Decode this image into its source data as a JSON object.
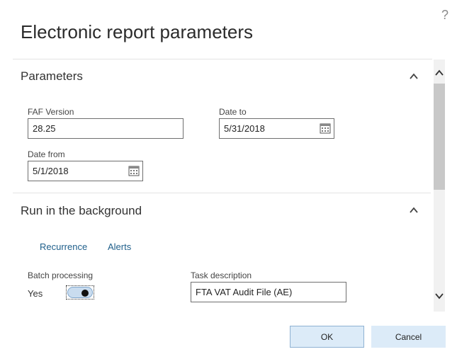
{
  "dialog": {
    "title": "Electronic report parameters",
    "help": "?"
  },
  "parameters": {
    "heading": "Parameters",
    "faf_version": {
      "label": "FAF Version",
      "value": "28.25"
    },
    "date_to": {
      "label": "Date to",
      "value": "5/31/2018"
    },
    "date_from": {
      "label": "Date from",
      "value": "5/1/2018"
    }
  },
  "background": {
    "heading": "Run in the background",
    "links": {
      "recurrence": "Recurrence",
      "alerts": "Alerts"
    },
    "batch": {
      "label": "Batch processing",
      "state_text": "Yes",
      "enabled": true
    },
    "task": {
      "label": "Task description",
      "value": "FTA VAT Audit File (AE)"
    }
  },
  "footer": {
    "ok": "OK",
    "cancel": "Cancel"
  },
  "icons": {
    "collapse": "chevron-up-icon",
    "calendar": "calendar-icon",
    "scroll_up": "scroll-up-icon",
    "scroll_down": "scroll-down-icon"
  },
  "colors": {
    "accent": "#1f5f8b",
    "button_bg": "#dcebf8",
    "toggle_bg": "#c9dcef"
  }
}
